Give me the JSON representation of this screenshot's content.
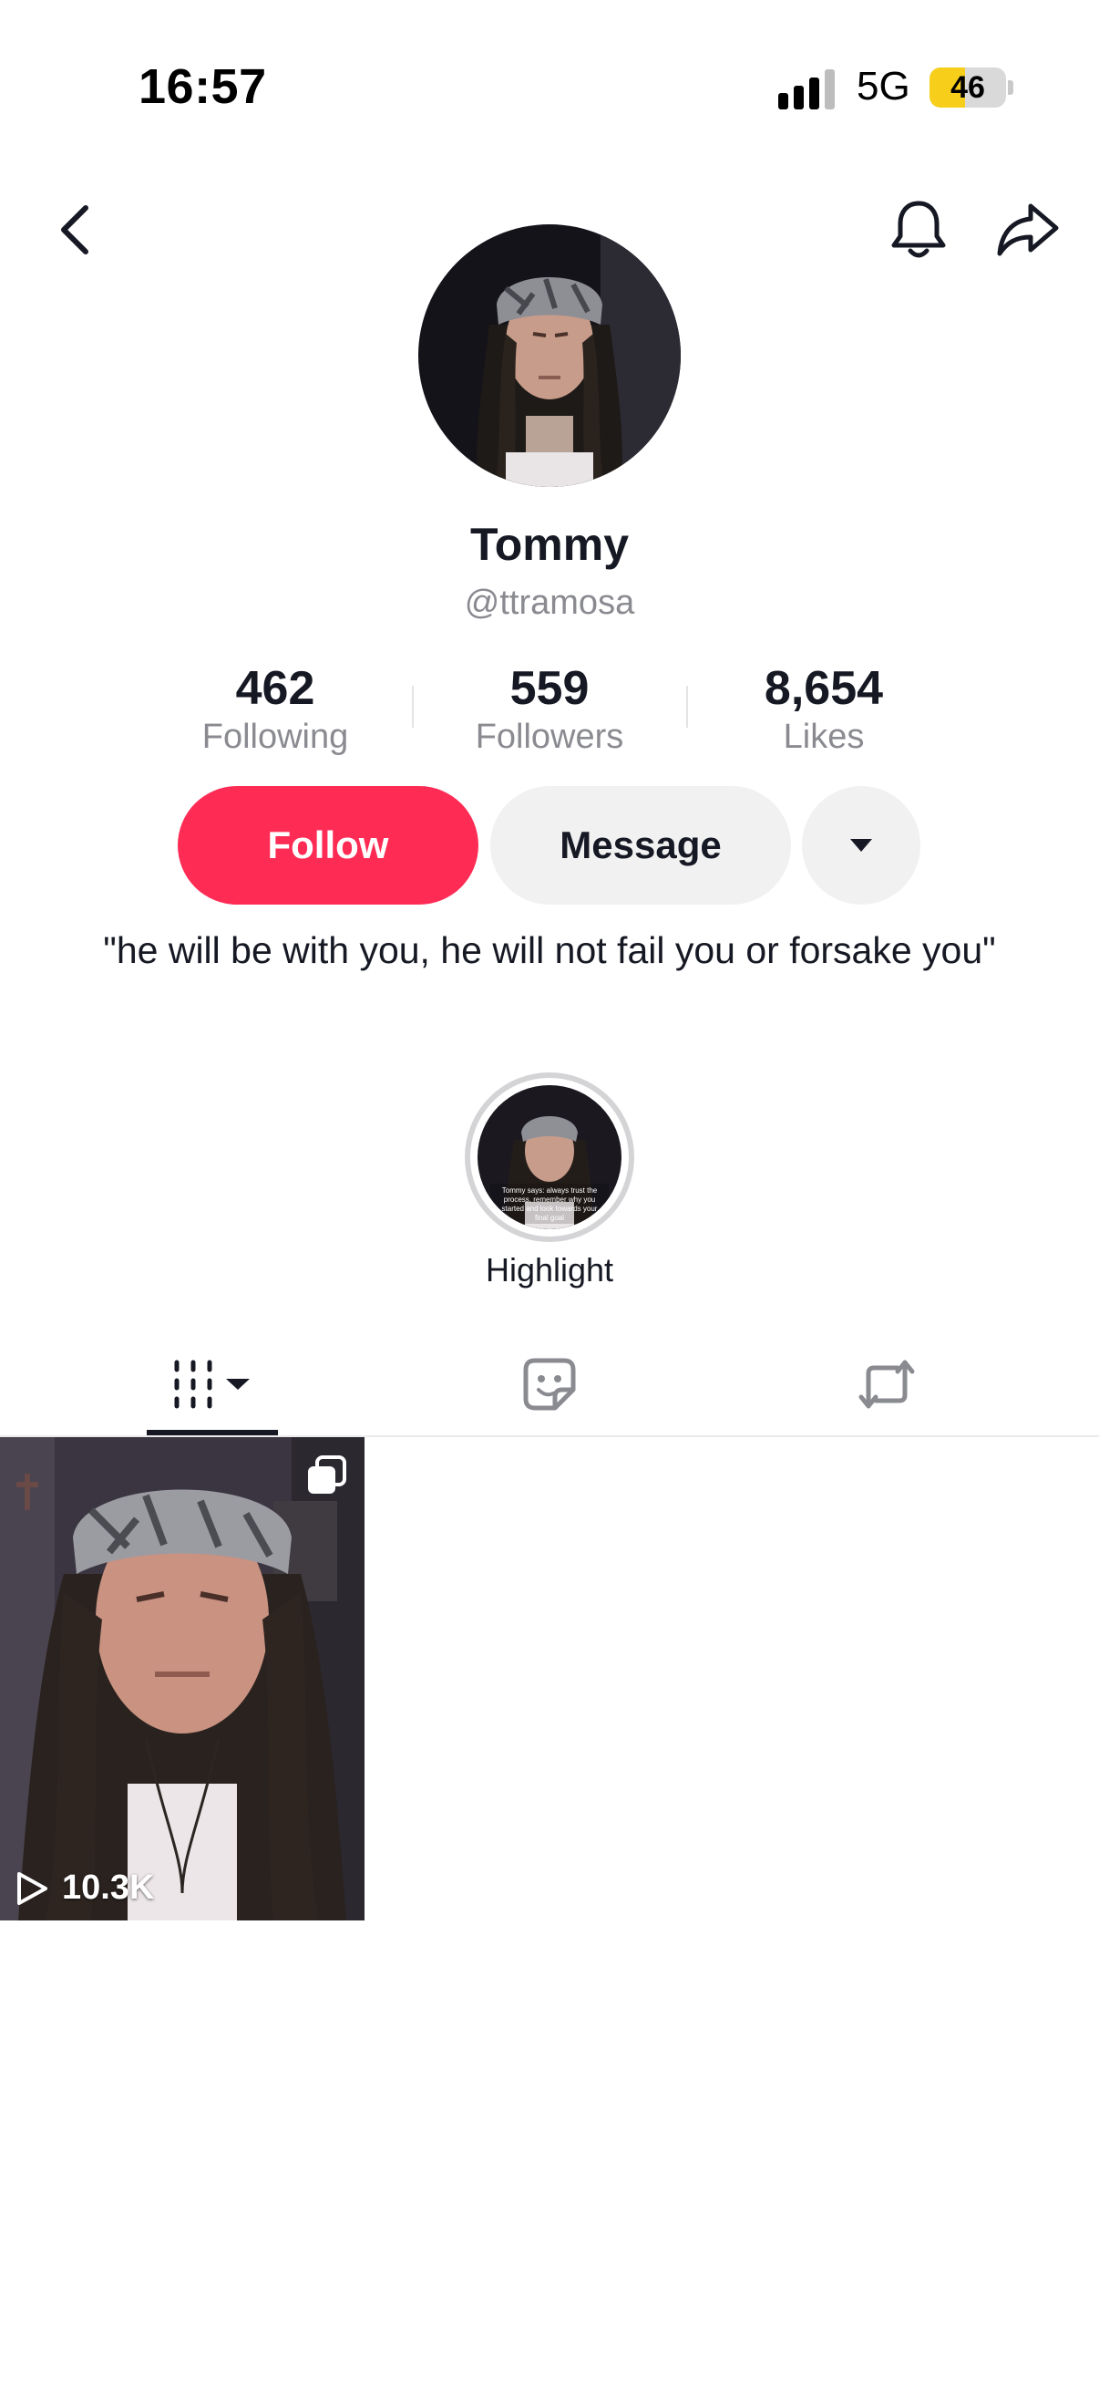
{
  "status_bar": {
    "time": "16:57",
    "network": "5G",
    "battery_level": "46",
    "battery_fraction": 0.46,
    "battery_color": "#f7ce1a"
  },
  "nav": {
    "back_icon": "chevron-left-icon",
    "bell_icon": "bell-icon",
    "share_icon": "share-arrow-icon"
  },
  "profile": {
    "display_name": "Tommy",
    "handle": "@ttramosa",
    "bio": "\"he will be with you, he will not fail you or forsake you\""
  },
  "stats": [
    {
      "value": "462",
      "label": "Following"
    },
    {
      "value": "559",
      "label": "Followers"
    },
    {
      "value": "8,654",
      "label": "Likes"
    }
  ],
  "actions": {
    "follow_label": "Follow",
    "message_label": "Message",
    "more_icon": "caret-down-icon",
    "accent": "#fe2c55"
  },
  "highlight": {
    "label": "Highlight",
    "thumb_caption": "Tommy says: always trust the process, remember why you started and look towards your final goal"
  },
  "tabs": [
    {
      "name": "videos",
      "icon": "grid-videos-icon",
      "active": true
    },
    {
      "name": "stickers",
      "icon": "sticker-icon",
      "active": false
    },
    {
      "name": "reposts",
      "icon": "repost-icon",
      "active": false
    }
  ],
  "videos": [
    {
      "views": "10.3K",
      "pinned_icon": "multi-photo-icon"
    }
  ]
}
